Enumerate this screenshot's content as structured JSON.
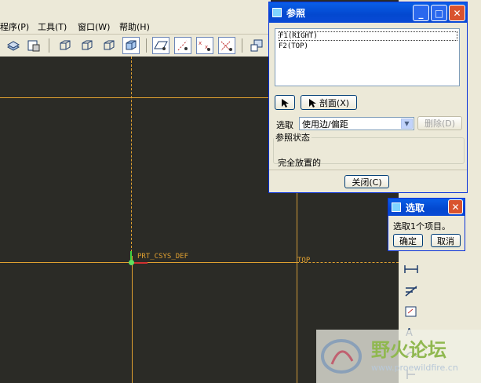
{
  "menu": {
    "items": [
      "程序(P)",
      "工具(T)",
      "窗口(W)",
      "帮助(H)"
    ]
  },
  "canvas": {
    "csys_label": "PRT_CSYS_DEF",
    "datum_label": "TOP",
    "colors": {
      "background": "#2b2b26",
      "datum_line": "#e0a030",
      "csys": "#40d040"
    }
  },
  "ref_dialog": {
    "title": "参照",
    "items": [
      "F1(RIGHT)",
      "F2(TOP)"
    ],
    "section_button": "剖面(X)",
    "select_label": "选取",
    "select_value": "使用边/偏距",
    "delete_button": "删除(D)",
    "status_legend": "参照状态",
    "status_text": "完全放置的",
    "close_button": "关闭(C)"
  },
  "select_dialog": {
    "title": "选取",
    "message": "选取1个项目。",
    "ok_button": "确定",
    "cancel_button": "取消"
  },
  "watermark": {
    "text": "野火论坛",
    "url": "www.proewildfire.cn"
  }
}
